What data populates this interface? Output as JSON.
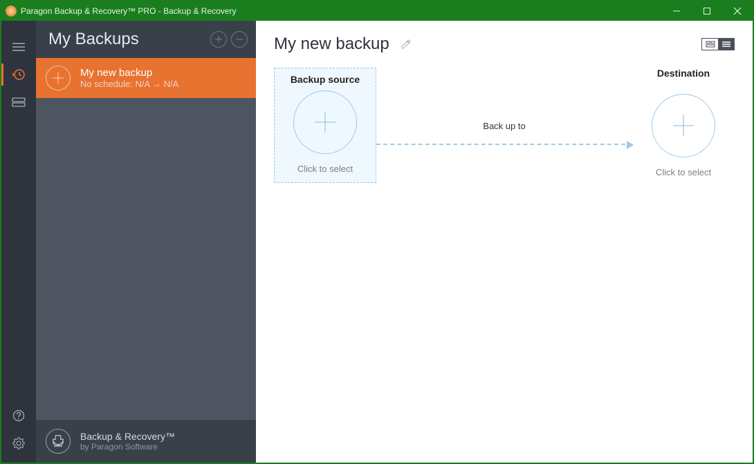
{
  "titlebar": {
    "title": "Paragon Backup & Recovery™ PRO - Backup & Recovery"
  },
  "sidebar": {
    "heading": "My Backups",
    "backup": {
      "name": "My new backup",
      "subtitle": "No schedule: N/A → N/A"
    },
    "footer": {
      "product": "Backup & Recovery™",
      "vendor": "by Paragon Software"
    }
  },
  "main": {
    "title": "My new backup",
    "source": {
      "title": "Backup source",
      "caption": "Click to select"
    },
    "arrow_label": "Back up to",
    "destination": {
      "title": "Destination",
      "caption": "Click to select"
    }
  }
}
